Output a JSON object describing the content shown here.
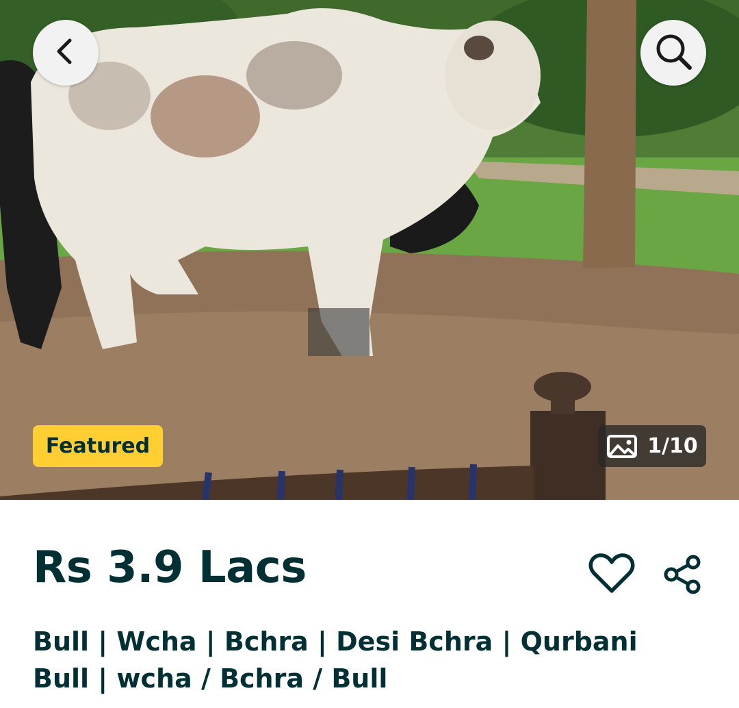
{
  "hero": {
    "featured_label": "Featured",
    "image_counter": "1/10"
  },
  "icons": {
    "back": "chevron-left-icon",
    "search": "search-icon",
    "gallery": "image-icon",
    "favorite": "heart-icon",
    "share": "share-icon"
  },
  "listing": {
    "price": "Rs 3.9 Lacs",
    "title": "Bull | Wcha | Bchra | Desi Bchra | Qurbani Bull | wcha / Bchra / Bull"
  },
  "colors": {
    "text": "#002f34",
    "featured": "#ffce32"
  }
}
